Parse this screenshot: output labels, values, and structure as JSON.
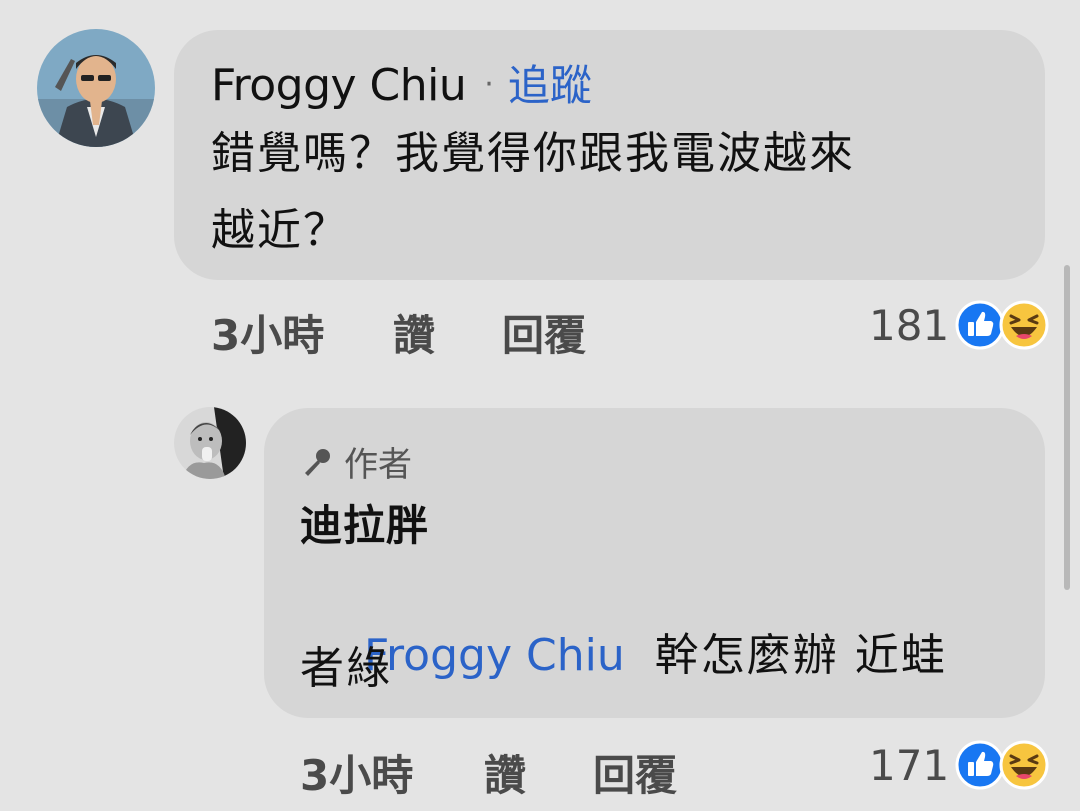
{
  "comment": {
    "author": "Froggy Chiu",
    "separator": "·",
    "follow_label": "追蹤",
    "text_line1": "錯覺嗎？我覺得你跟我電波越來",
    "text_line2": "越近？",
    "time": "3小時",
    "like_label": "讚",
    "reply_label": "回覆",
    "reaction_count": "181",
    "reactions": [
      "like-icon",
      "haha-icon"
    ]
  },
  "reply": {
    "badge_icon": "microphone-icon",
    "badge_label": "作者",
    "author": "迪拉胖",
    "mention": "Froggy Chiu",
    "text_line1": "幹怎麼辦 近蛙",
    "text_line2": "者綠",
    "time": "3小時",
    "like_label": "讚",
    "reply_label": "回覆",
    "reaction_count": "171",
    "reactions": [
      "like-icon",
      "haha-icon"
    ]
  },
  "colors": {
    "background": "#e4e4e4",
    "bubble": "#d6d6d6",
    "link_blue": "#2b63c8",
    "like_blue": "#1877f2",
    "haha_yellow": "#f7c53f"
  }
}
